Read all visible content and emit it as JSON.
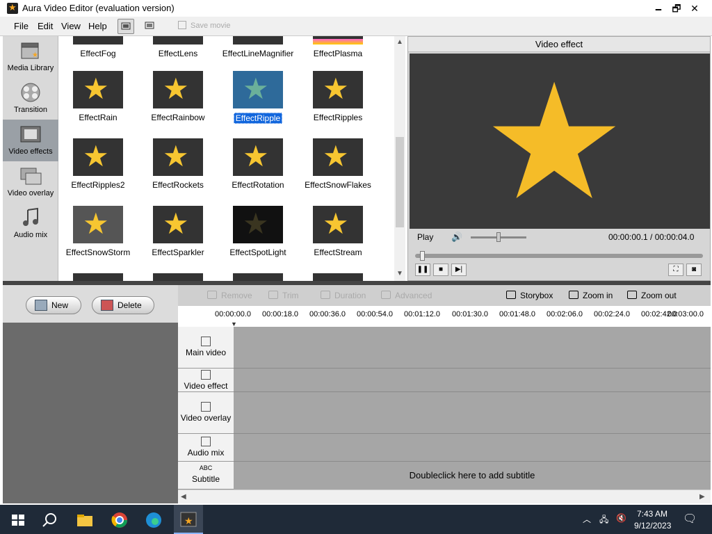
{
  "window": {
    "title": "Aura Video Editor (evaluation version)",
    "min": "🗕",
    "max": "🗗",
    "close": "✕"
  },
  "menu": [
    "File",
    "Edit",
    "View",
    "Help"
  ],
  "toolbar": {
    "save_movie": "Save movie"
  },
  "sidebar": [
    {
      "label": "Media Library",
      "icon": "clapperboard-icon"
    },
    {
      "label": "Transition",
      "icon": "transition-icon"
    },
    {
      "label": "Video effects",
      "icon": "film-effects-icon",
      "active": true
    },
    {
      "label": "Video overlay",
      "icon": "overlay-icon"
    },
    {
      "label": "Audio mix",
      "icon": "music-note-icon"
    }
  ],
  "effects": [
    {
      "label": "EffectFog"
    },
    {
      "label": "EffectLens"
    },
    {
      "label": "EffectLineMagnifier"
    },
    {
      "label": "EffectPlasma"
    },
    {
      "label": "EffectRain"
    },
    {
      "label": "EffectRainbow"
    },
    {
      "label": "EffectRipple",
      "selected": true
    },
    {
      "label": "EffectRipples"
    },
    {
      "label": "EffectRipples2"
    },
    {
      "label": "EffectRockets"
    },
    {
      "label": "EffectRotation"
    },
    {
      "label": "EffectSnowFlakes"
    },
    {
      "label": "EffectSnowStorm"
    },
    {
      "label": "EffectSparkler"
    },
    {
      "label": "EffectSpotLight"
    },
    {
      "label": "EffectStream"
    }
  ],
  "preview": {
    "title": "Video effect",
    "play": "Play",
    "time": "00:00:00.1 / 00:00:04.0",
    "volume_level": 0.5,
    "seek_position": 0.025
  },
  "timeline_buttons": {
    "new": "New",
    "delete": "Delete"
  },
  "tools": [
    {
      "label": "Remove",
      "enabled": false
    },
    {
      "label": "Trim",
      "enabled": false
    },
    {
      "label": "Duration",
      "enabled": false
    },
    {
      "label": "Advanced",
      "enabled": false
    },
    {
      "label": "Storybox",
      "enabled": true
    },
    {
      "label": "Zoom in",
      "enabled": true
    },
    {
      "label": "Zoom out",
      "enabled": true
    }
  ],
  "ruler": [
    "00:00:00.0",
    "00:00:18.0",
    "00:00:36.0",
    "00:00:54.0",
    "00:01:12.0",
    "00:01:30.0",
    "00:01:48.0",
    "00:02:06.0",
    "00:02:24.0",
    "00:02:42.0",
    "00:03:00.0"
  ],
  "tracks": [
    {
      "label": "Main video"
    },
    {
      "label": "Video effect"
    },
    {
      "label": "Video overlay"
    },
    {
      "label": "Audio mix"
    },
    {
      "label": "Subtitle",
      "icon_text": "ABC"
    }
  ],
  "subtitle_hint": "Doubleclick here to add subtitle",
  "taskbar": {
    "time": "7:43 AM",
    "date": "9/12/2023"
  }
}
